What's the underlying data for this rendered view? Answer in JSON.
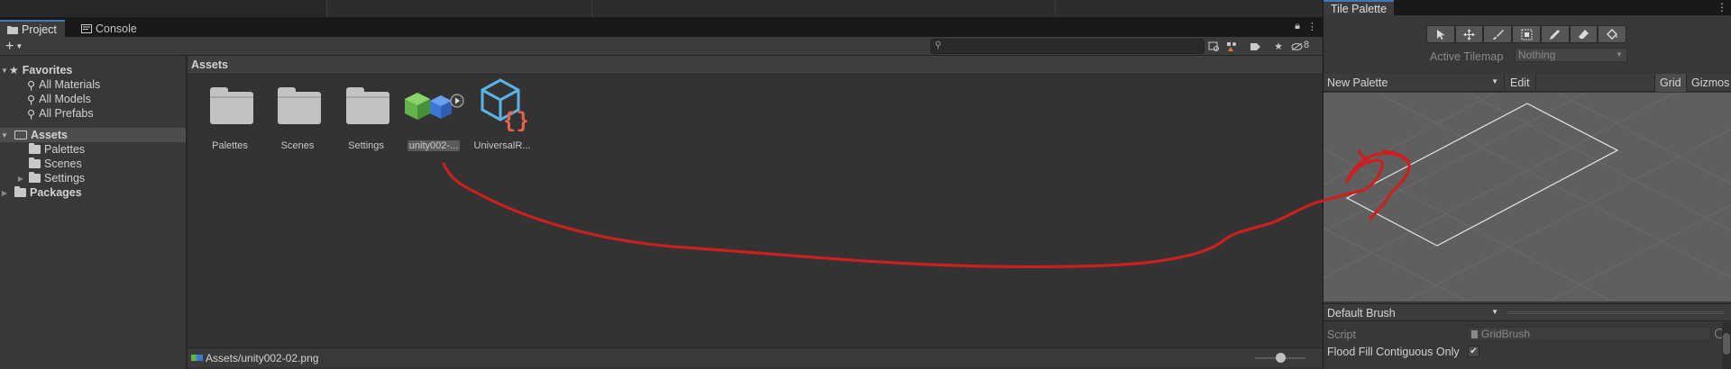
{
  "project_window": {
    "tabs": [
      {
        "label": "Project",
        "icon": "folder-icon",
        "active": true
      },
      {
        "label": "Console",
        "icon": "console-icon",
        "active": false
      }
    ],
    "toolbar": {
      "create_label": "+",
      "search_value": "",
      "hidden_count": "8"
    },
    "tree": {
      "favorites": {
        "label": "Favorites",
        "items": [
          "All Materials",
          "All Models",
          "All Prefabs"
        ]
      },
      "assets": {
        "label": "Assets",
        "children": [
          "Palettes",
          "Scenes",
          "Settings"
        ]
      },
      "packages": {
        "label": "Packages"
      }
    },
    "assets_pane": {
      "header": "Assets",
      "items": [
        {
          "label": "Palettes",
          "type": "folder"
        },
        {
          "label": "Scenes",
          "type": "folder"
        },
        {
          "label": "Settings",
          "type": "folder"
        },
        {
          "label": "unity002-...",
          "type": "image",
          "selected": true
        },
        {
          "label": "UniversalR...",
          "type": "script"
        }
      ]
    },
    "status": {
      "path": "Assets/unity002-02.png",
      "zoom_fraction": 0.5
    }
  },
  "tile_palette": {
    "title": "Tile Palette",
    "tools": [
      "select-tool",
      "move-tool",
      "paint-tool",
      "box-fill-tool",
      "pick-tool",
      "erase-tool",
      "fill-tool"
    ],
    "active_tilemap_label": "Active Tilemap",
    "active_tilemap_value": "Nothing",
    "palette_name": "New Palette",
    "edit_label": "Edit",
    "grid_label": "Grid",
    "gizmos_label": "Gizmos",
    "brush_name": "Default Brush",
    "script_label": "Script",
    "script_value": "GridBrush",
    "flood_fill_label": "Flood Fill Contiguous Only",
    "flood_fill_checked": true
  },
  "colors": {
    "annotation_stroke": "#cc1f1f",
    "tab_accent": "#3a79bb",
    "canvas_bg": "#5f5f5f"
  }
}
